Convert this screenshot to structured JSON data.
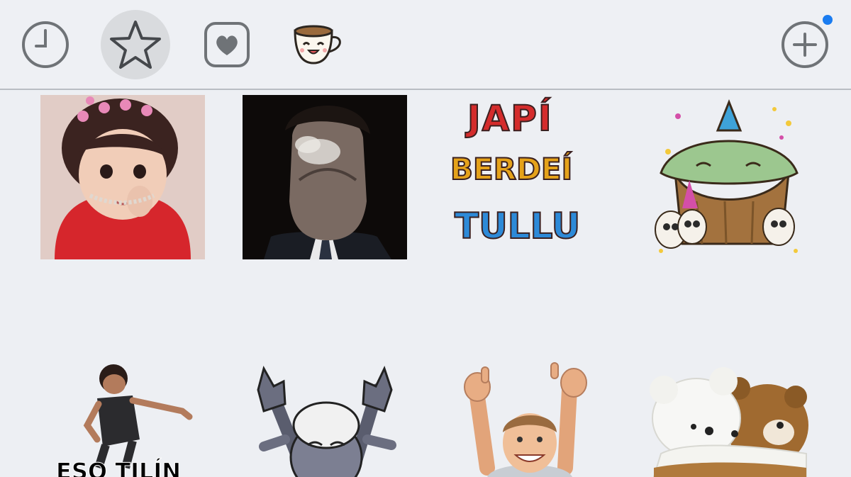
{
  "tabs": [
    {
      "name": "recent",
      "icon": "clock-icon",
      "active": false
    },
    {
      "name": "favorites",
      "icon": "star-icon",
      "active": true
    },
    {
      "name": "heart-stickers",
      "icon": "heart-icon",
      "active": false
    },
    {
      "name": "coffee-pack",
      "icon": "coffee-cup-icon",
      "active": false
    }
  ],
  "add_button": {
    "icon": "plus-circle-icon",
    "badge_color": "#1a7cf0"
  },
  "stickers": {
    "japi_line1": "JAPÍ",
    "japi_line2": "BERDEÍ",
    "japi_line3": "TULLU",
    "eso_caption": "ESO TILÍN"
  },
  "colors": {
    "background": "#edeff3",
    "icon_gray": "#6f7377",
    "active_tab_bg": "#d9dbde"
  }
}
